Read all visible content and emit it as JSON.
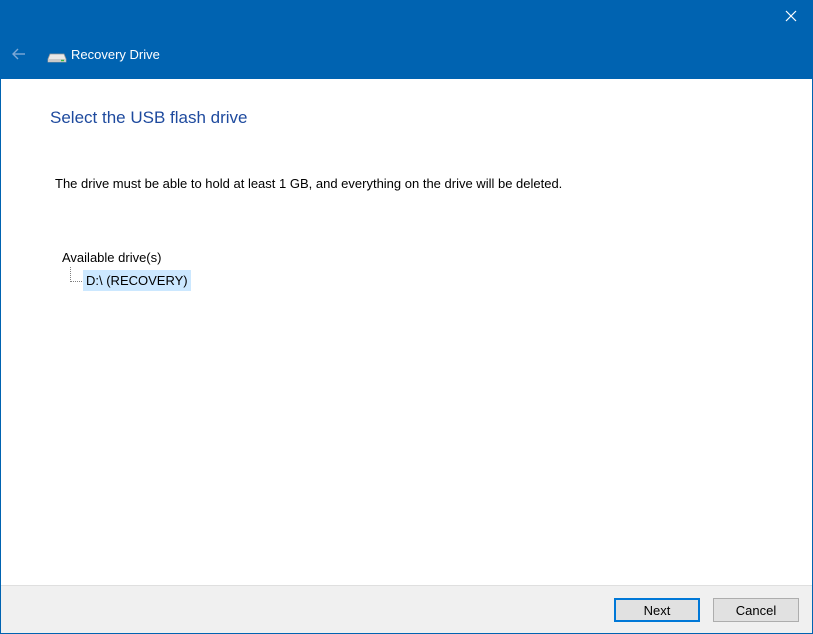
{
  "window": {
    "title": "Recovery Drive",
    "accent_color": "#0063b1",
    "icons": {
      "close": "close-icon",
      "back": "back-arrow-icon",
      "app": "usb-drive-icon"
    }
  },
  "content": {
    "heading": "Select the USB flash drive",
    "heading_color": "#1e4a9e",
    "description": "The drive must be able to hold at least 1 GB, and everything on the drive will be deleted.",
    "drives_label": "Available drive(s)",
    "drives": [
      {
        "label": "D:\\ (RECOVERY)",
        "selected": true
      }
    ]
  },
  "footer": {
    "next_label": "Next",
    "cancel_label": "Cancel"
  }
}
